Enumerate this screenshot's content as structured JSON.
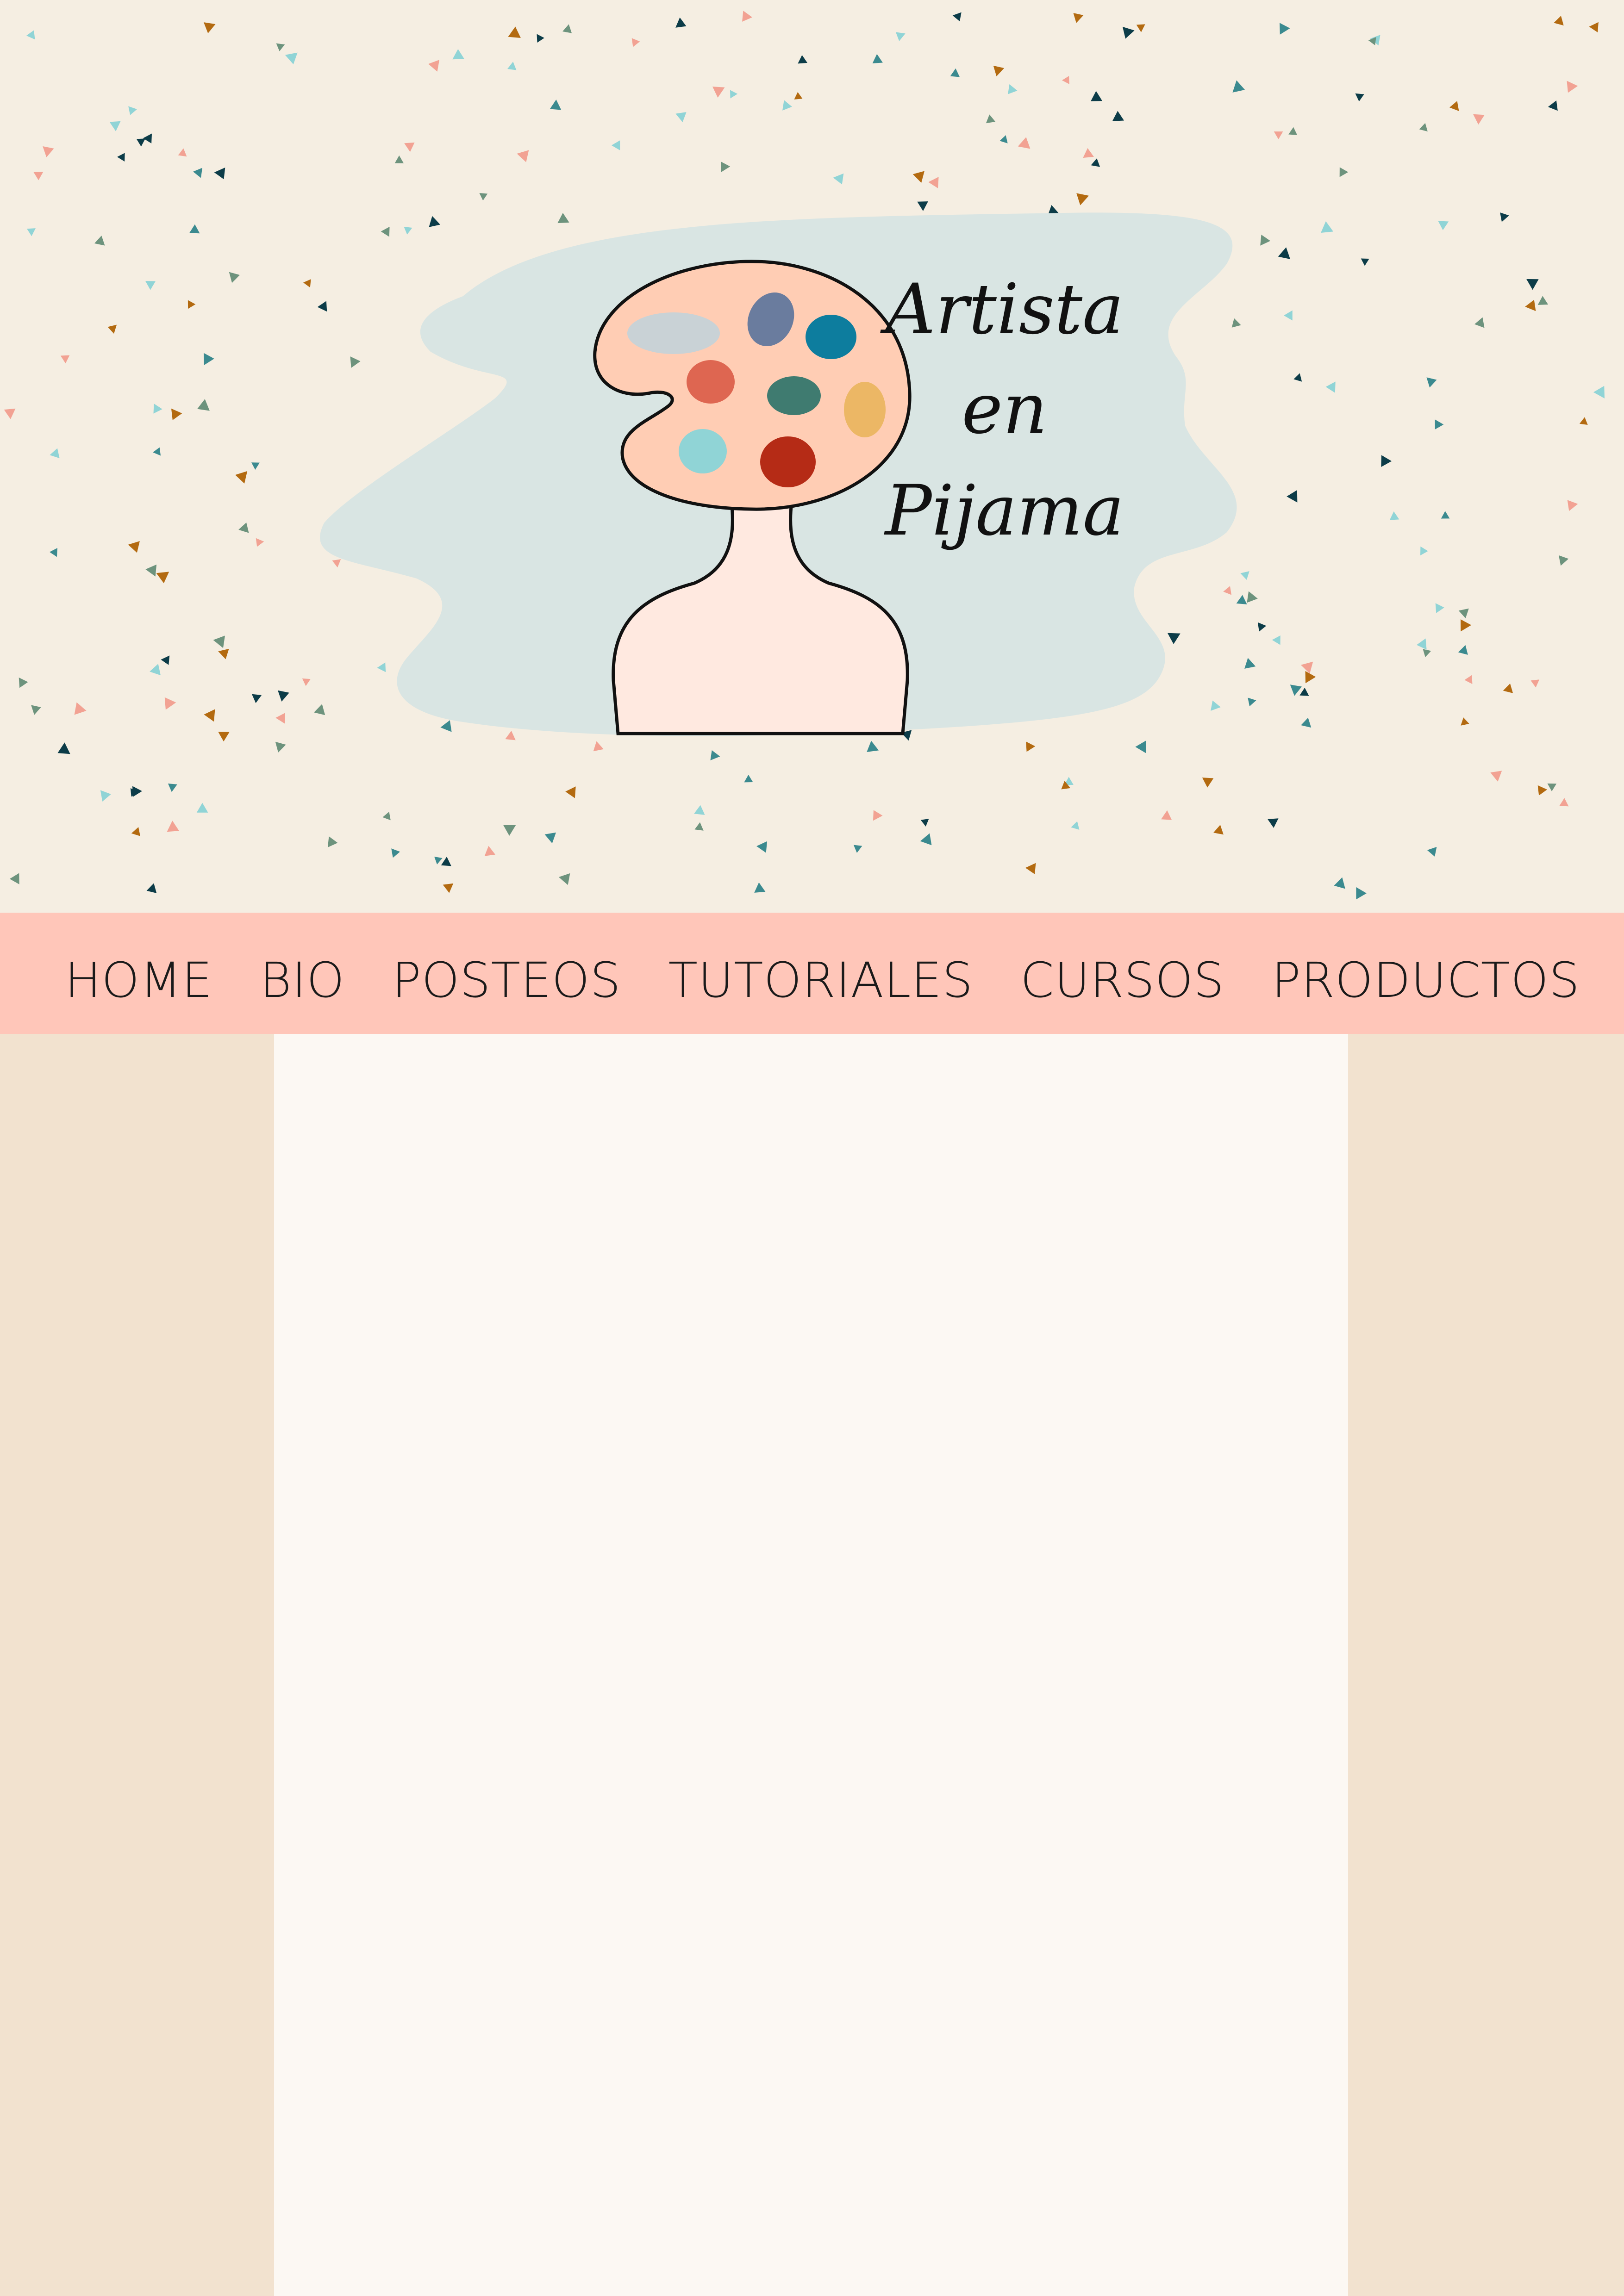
{
  "header": {
    "logo": {
      "lines": [
        "Artista",
        "en",
        "Pijama"
      ]
    },
    "colors": {
      "background": "#f5eee2",
      "blob": "#d9e5e3",
      "palette": "#ffcdb4",
      "body": "#ffe9e0",
      "confetti": [
        "#3b8a8f",
        "#0c3c48",
        "#b36a10",
        "#f2a293",
        "#90d4d6",
        "#6d937d"
      ]
    }
  },
  "nav": {
    "items": [
      {
        "label": "HOME"
      },
      {
        "label": "BIO"
      },
      {
        "label": "POSTEOS"
      },
      {
        "label": "TUTORIALES"
      },
      {
        "label": "CURSOS"
      },
      {
        "label": "PRODUCTOS"
      }
    ],
    "color": "#ffc6b9"
  },
  "layout_colors": {
    "side_columns": "#f2e2cf",
    "content_panel": "#fcf8f3"
  }
}
